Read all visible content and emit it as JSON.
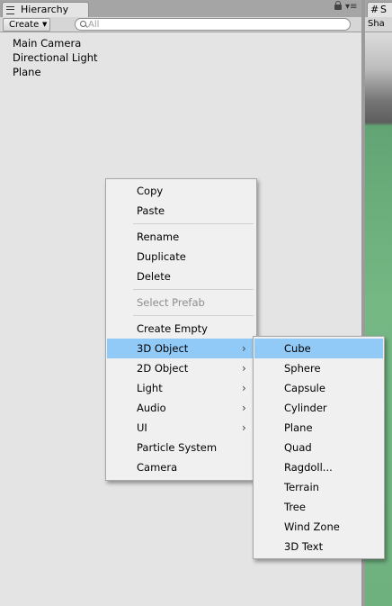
{
  "hierarchy": {
    "tab_title": "Hierarchy",
    "create_label": "Create",
    "search_placeholder": "All",
    "items": [
      "Main Camera",
      "Directional Light",
      "Plane"
    ]
  },
  "scene": {
    "tab_title": "S",
    "toolbar_label": "Sha"
  },
  "context_menu": {
    "copy": "Copy",
    "paste": "Paste",
    "rename": "Rename",
    "duplicate": "Duplicate",
    "delete": "Delete",
    "select_prefab": "Select Prefab",
    "create_empty": "Create Empty",
    "object_3d": "3D Object",
    "object_2d": "2D Object",
    "light": "Light",
    "audio": "Audio",
    "ui": "UI",
    "particle_system": "Particle System",
    "camera": "Camera"
  },
  "submenu_3d": {
    "cube": "Cube",
    "sphere": "Sphere",
    "capsule": "Capsule",
    "cylinder": "Cylinder",
    "plane": "Plane",
    "quad": "Quad",
    "ragdoll": "Ragdoll...",
    "terrain": "Terrain",
    "tree": "Tree",
    "wind_zone": "Wind Zone",
    "text_3d": "3D Text"
  },
  "colors": {
    "highlight": "#91c9f7",
    "panel_bg": "#e4e4e4",
    "menu_bg": "#f0f0f0"
  }
}
